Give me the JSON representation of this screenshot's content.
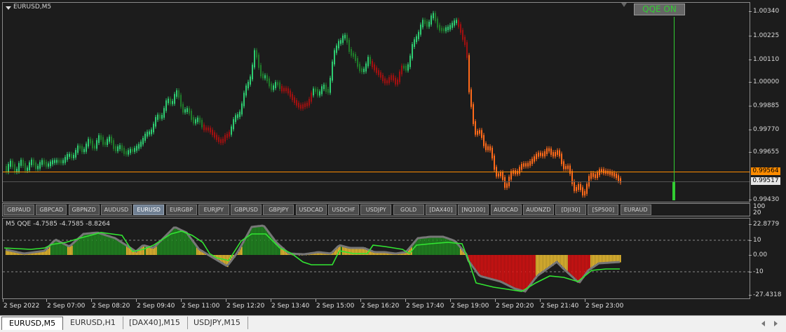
{
  "main_chart": {
    "title": "EURUSD,M5",
    "qqe_button": "QQE ON",
    "price_labels": [
      "1.00340",
      "1.00225",
      "1.00110",
      "1.00000",
      "0.99885",
      "0.99770",
      "0.99655",
      "0.99430"
    ],
    "current_price": "0.99564",
    "bid_price": "0.99517",
    "colors": {
      "bull": "#2ecc71",
      "bear": "#a01010",
      "orange": "#ff6a1a",
      "line": "#ff8c00",
      "accent": "#32cd32"
    }
  },
  "symbols": [
    "GBPAUD",
    "GBPCAD",
    "GBPNZD",
    "AUDUSD",
    "EURUSD",
    "EURGBP",
    "EURJPY",
    "GBPUSD",
    "GBPJPY",
    "USDCAD",
    "USDCHF",
    "USDJPY",
    "GOLD",
    "[DAX40]",
    "[NQ100]",
    "AUDCAD",
    "AUDNZD",
    "[DJI30]",
    "[SP500]",
    "EURAUD"
  ],
  "active_symbol": "EURUSD",
  "indicator": {
    "title": "M5 QQE -4.7585 -4.7585 -8.8264",
    "scale_top": "100",
    "scale_top2": "20",
    "levels": [
      "22.8779",
      "10",
      "0.00",
      "-10",
      "-27.4318"
    ]
  },
  "time_axis": [
    "2 Sep 2022",
    "2 Sep 07:00",
    "2 Sep 08:20",
    "2 Sep 09:40",
    "2 Sep 11:00",
    "2 Sep 12:20",
    "2 Sep 13:40",
    "2 Sep 15:00",
    "2 Sep 16:20",
    "2 Sep 17:40",
    "2 Sep 19:00",
    "2 Sep 20:20",
    "2 Sep 21:40",
    "2 Sep 23:00"
  ],
  "tabs": [
    "EURUSD,M5",
    "EURUSD,H1",
    "[DAX40],M15",
    "USDJPY,M15"
  ],
  "active_tab": "EURUSD,M5"
}
